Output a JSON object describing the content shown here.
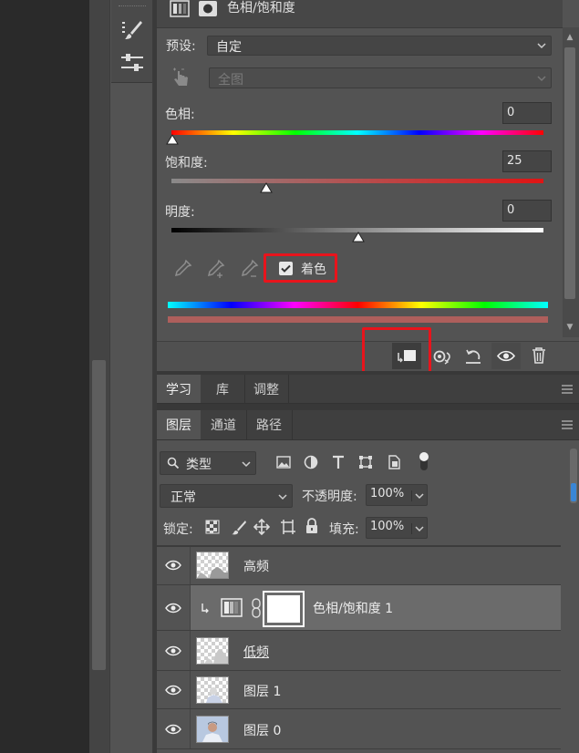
{
  "properties": {
    "title": "色相/饱和度",
    "preset_label": "预设:",
    "preset_value": "自定",
    "range_value": "全图",
    "hue": {
      "label": "色相:",
      "value": "0"
    },
    "saturation": {
      "label": "饱和度:",
      "value": "25"
    },
    "lightness": {
      "label": "明度:",
      "value": "0"
    },
    "colorize_label": "着色",
    "colorize_checked": true
  },
  "tabs_top": [
    {
      "label": "学习"
    },
    {
      "label": "库"
    },
    {
      "label": "调整"
    }
  ],
  "tabs_layers": [
    {
      "label": "图层"
    },
    {
      "label": "通道"
    },
    {
      "label": "路径"
    }
  ],
  "layers_panel": {
    "filter_label": "类型",
    "blend_mode": "正常",
    "opacity_label": "不透明度:",
    "opacity_value": "100%",
    "lock_label": "锁定:",
    "fill_label": "填充:",
    "fill_value": "100%",
    "layers": [
      {
        "name": "高频"
      },
      {
        "name": "色相/饱和度 1"
      },
      {
        "name": "低频"
      },
      {
        "name": "图层 1"
      },
      {
        "name": "图层 0"
      }
    ]
  },
  "colors": {
    "highlight_red": "#e8141c",
    "panel_bg": "#535353",
    "selected_row": "#6b6b6b"
  }
}
